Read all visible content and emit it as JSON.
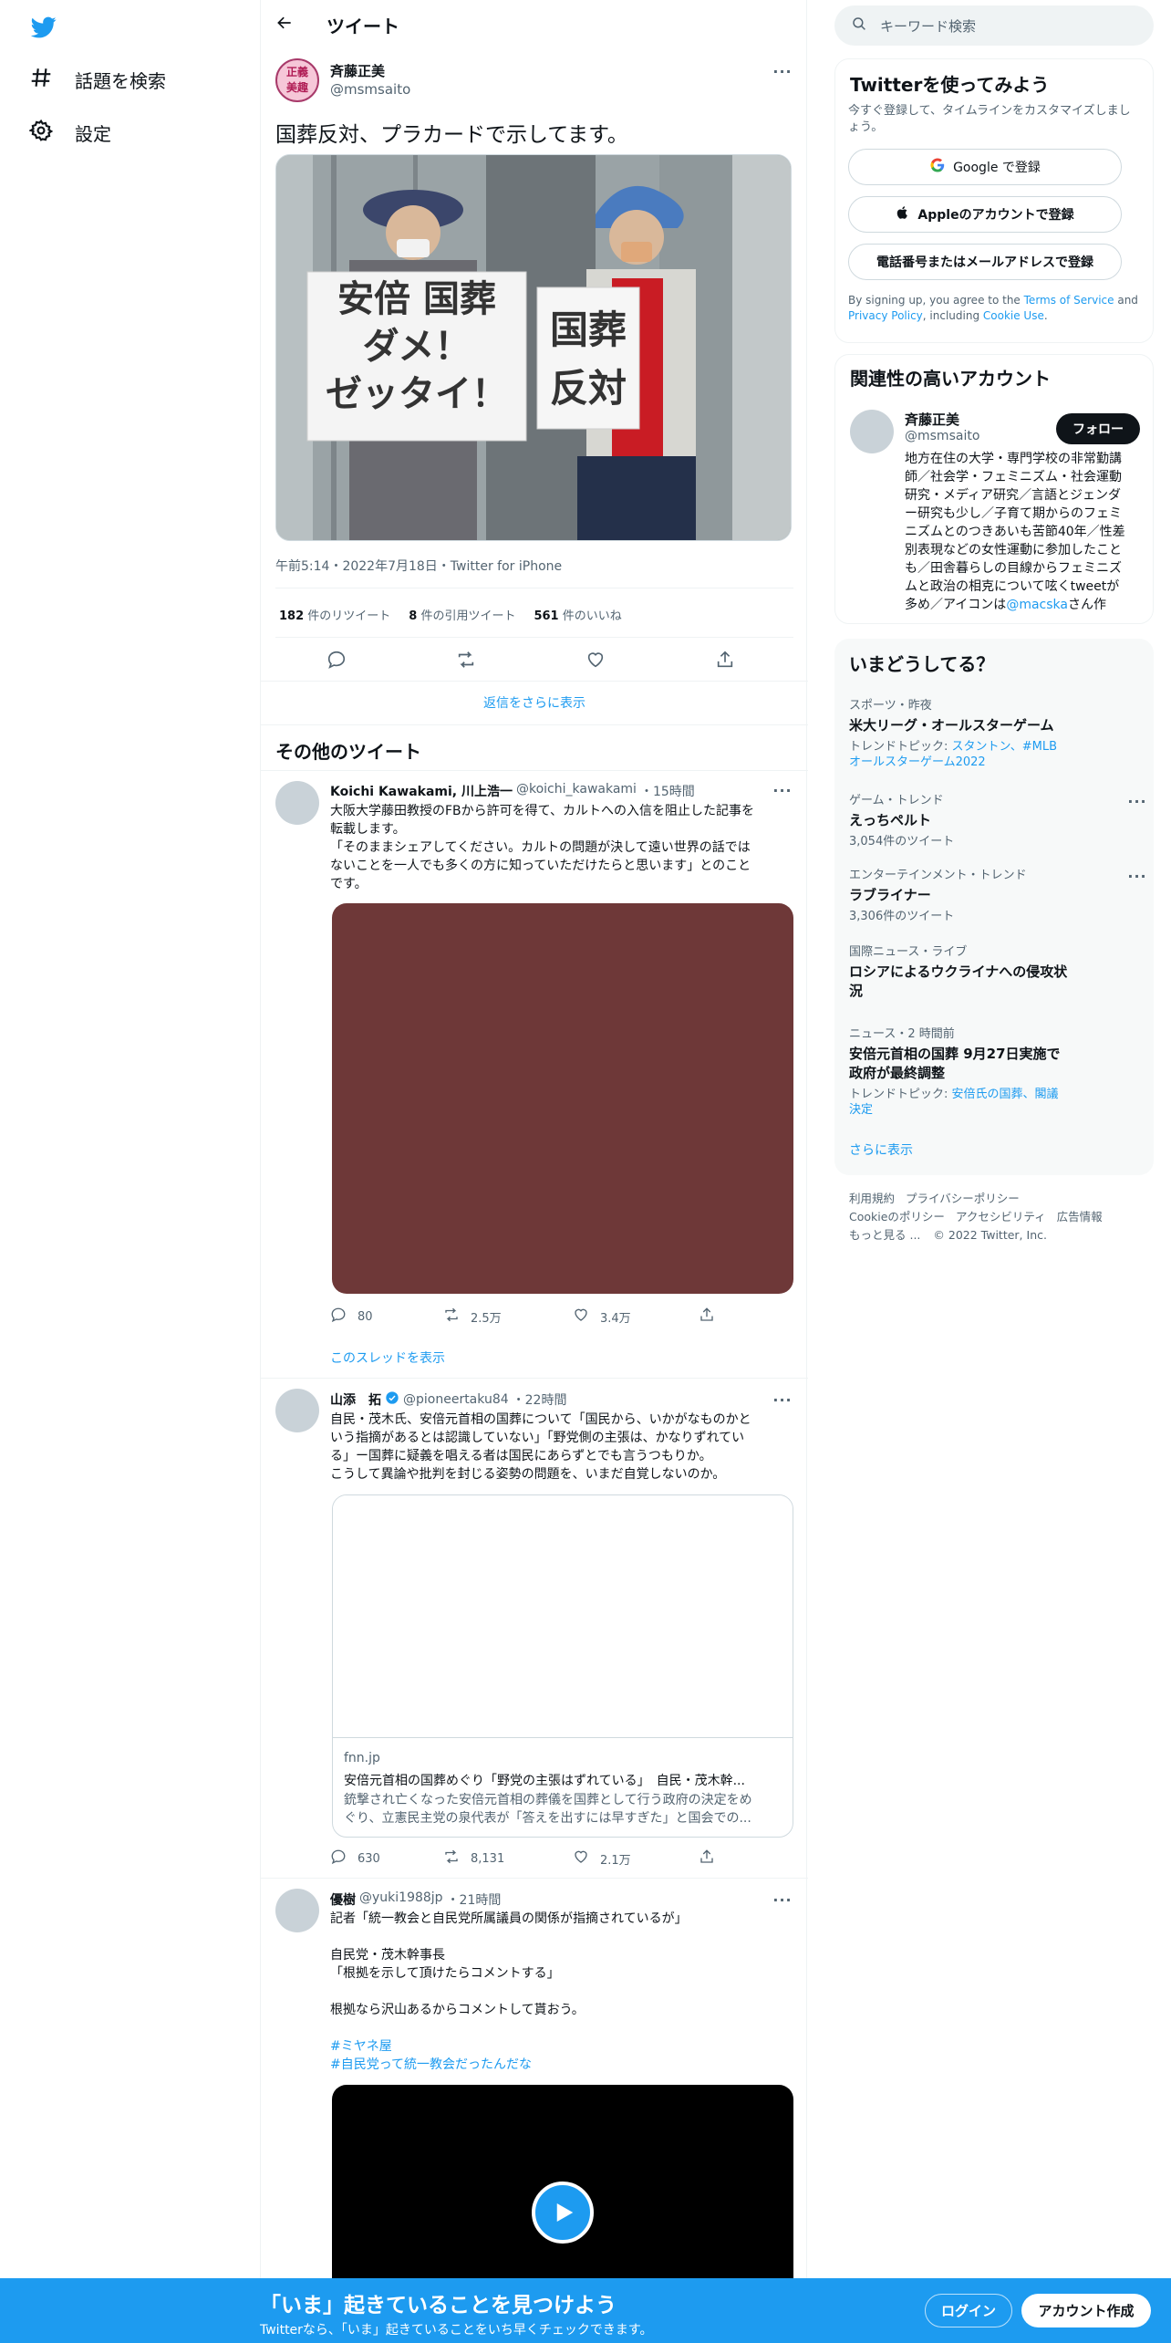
{
  "nav": {
    "items": [
      {
        "label": "話題を検索",
        "icon": "hashtag-icon"
      },
      {
        "label": "設定",
        "icon": "gear-icon"
      }
    ]
  },
  "header": {
    "title": "ツイート"
  },
  "main_tweet": {
    "display_name": "斉藤正美",
    "handle": "@msmsaito",
    "avatar_text": "正義 美趣",
    "text": "国葬反対、プラカードで示してます。",
    "sign_left": [
      "安倍 国葬",
      "ダメ！",
      "ゼッタイ！"
    ],
    "sign_right": [
      "国葬",
      "反対"
    ],
    "meta": "午前5:14・2022年7月18日・Twitter for iPhone",
    "retweets_num": "182",
    "retweets_label": " 件のリツイート",
    "quotes_num": "8",
    "quotes_label": " 件の引用ツイート",
    "likes_num": "561",
    "likes_label": " 件のいいね",
    "show_more_replies": "返信をさらに表示"
  },
  "more_tweets_title": "その他のツイート",
  "tweets": [
    {
      "display_name": "Koichi Kawakami, 川上浩一",
      "handle": "@koichi_kawakami",
      "time": "・15時間",
      "lines": [
        "大阪大学藤田教授のFBから許可を得て、カルトへの入信を阻止した記事を",
        "転載します。",
        "「そのままシェアしてください。カルトの問題が決して遠い世界の話では",
        "ないことを一人でも多くの方に知っていただけたらと思います」とのこと",
        "です。"
      ],
      "replies": "80",
      "retweets": "2.5万",
      "likes": "3.4万",
      "thread_link": "このスレッドを表示"
    },
    {
      "display_name": "山添　拓",
      "handle": "@pioneertaku84",
      "time": "・22時間",
      "lines": [
        "自民・茂木氏、安倍元首相の国葬について「国民から、いかがなものかと",
        "いう指摘があるとは認識していない」「野党側の主張は、かなりずれてい",
        "る」ー国葬に疑義を唱える者は国民にあらずとでも言うつもりか。",
        "こうして異論や批判を封じる姿勢の問題を、いまだ自覚しないのか。"
      ],
      "card_domain": "fnn.jp",
      "card_title": "安倍元首相の国葬めぐり「野党の主張はずれている」　自民・茂木幹...",
      "card_desc_1": "銃撃され亡くなった安倍元首相の葬儀を国葬として行う政府の決定をめ",
      "card_desc_2": "ぐり、立憲民主党の泉代表が「答えを出すには早すぎた」と国会での...",
      "replies": "630",
      "retweets": "8,131",
      "likes": "2.1万"
    },
    {
      "display_name": "優樹",
      "handle": "@yuki1988jp",
      "time": "・21時間",
      "lines": [
        "記者「統一教会と自民党所属議員の関係が指摘されているが」",
        "",
        "自民党・茂木幹事長",
        "「根拠を示して頂けたらコメントする」",
        "",
        "根拠なら沢山あるからコメントして貰おう。"
      ],
      "hashtags": [
        "#ミヤネ屋",
        "#自民党って統一教会だったんだな"
      ]
    }
  ],
  "search": {
    "placeholder": "キーワード検索"
  },
  "signup": {
    "title": "Twitterを使ってみよう",
    "subtitle": "今すぐ登録して、タイムラインをカスタマイズしましょう。",
    "google": "Google で登録",
    "apple": "Appleのアカウントで登録",
    "phone": "電話番号またはメールアドレスで登録",
    "terms_1": "By signing up, you agree to the ",
    "terms_link": "Terms of Service",
    "terms_2": " and",
    "privacy_link": "Privacy Policy",
    "terms_3": ", including ",
    "cookie_link": "Cookie Use",
    "terms_4": "."
  },
  "related": {
    "title": "関連性の高いアカウント",
    "name": "斉藤正美",
    "handle": "@msmsaito",
    "follow": "フォロー",
    "bio_lines": [
      "地方在住の大学・専門学校の非常勤講",
      "師／社会学・フェミニズム・社会運動",
      "研究・メディア研究／言語とジェンダ",
      "ー研究も少し／子育て期からのフェミ",
      "ニズムとのつきあいも苦節40年／性差",
      "別表現などの女性運動に参加したこと",
      "も／田舎暮らしの目線からフェミニズ",
      "ムと政治の相克について呟くtweetが"
    ],
    "bio_last_1": "多め／アイコンは",
    "bio_mention": "@macska",
    "bio_last_2": "さん作"
  },
  "trends": {
    "title": "いまどうしてる？",
    "items": [
      {
        "cat": "スポーツ・昨夜",
        "name": "米大リーグ・オールスターゲーム",
        "sub_1": "トレンドトピック: ",
        "sub_link": "スタントン、#MLB オールスターゲーム2022"
      },
      {
        "cat": "ゲーム・トレンド",
        "name": "えっちペルト",
        "sub_plain": "3,054件のツイート"
      },
      {
        "cat": "エンターテインメント・トレンド",
        "name": "ラブライナー",
        "sub_plain": "3,306件のツイート"
      },
      {
        "cat": "国際ニュース・ライブ",
        "name": "ロシアによるウクライナへの侵攻状況"
      },
      {
        "cat": "ニュース・2 時間前",
        "name": "安倍元首相の国葬 9月27日実施で政府が最終調整",
        "sub_1": "トレンドトピック: ",
        "sub_link": "安倍氏の国葬、閣議決定"
      }
    ],
    "show_more": "さらに表示"
  },
  "footer": {
    "row1": [
      "利用規約",
      "プライバシーポリシー"
    ],
    "row2": [
      "Cookieのポリシー",
      "アクセシビリティ",
      "広告情報"
    ],
    "row3_more": "もっと見る ...",
    "copyright": "© 2022 Twitter, Inc."
  },
  "banner": {
    "title": "「いま」起きていることを見つけよう",
    "subtitle": "Twitterなら、「いま」起きていることをいち早くチェックできます。",
    "login": "ログイン",
    "signup": "アカウント作成"
  },
  "colors": {
    "accent": "#1d9bf0",
    "text": "#0f1419",
    "muted": "#536471",
    "border": "#eff3f4",
    "media_placeholder": "#6e3838"
  }
}
